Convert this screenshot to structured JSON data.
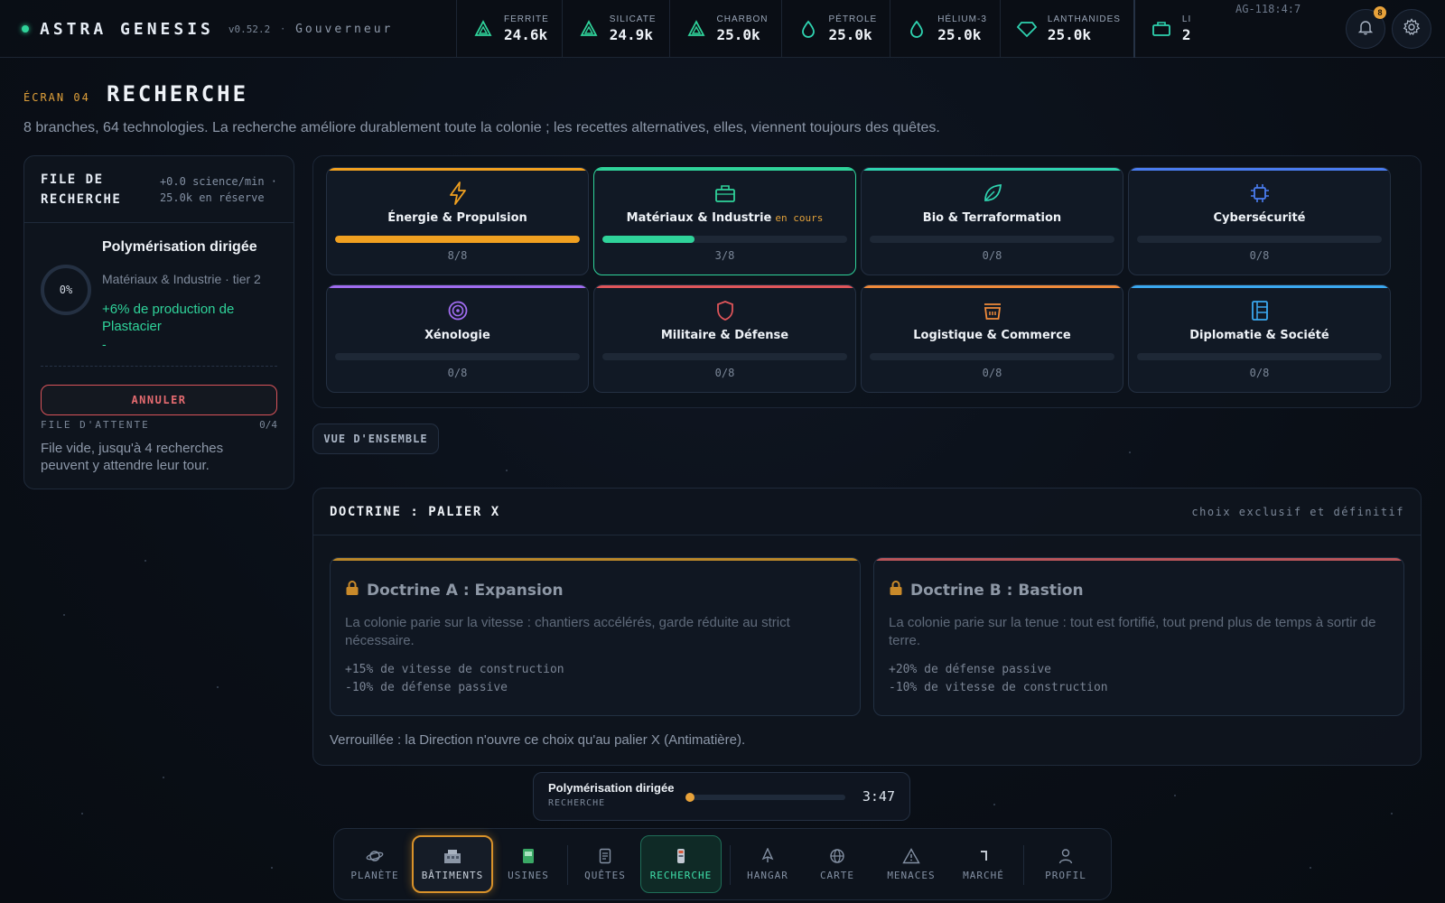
{
  "app": {
    "name": "ASTRA GENESIS",
    "version": "v0.52.2",
    "separator": "·",
    "role": "Gouverneur",
    "coords": "AG-118:4:7",
    "notifications": "8"
  },
  "resources": [
    {
      "name": "FERRITE",
      "value": "24.6k",
      "icon": "triangle-icon"
    },
    {
      "name": "SILICATE",
      "value": "24.9k",
      "icon": "triangle-icon"
    },
    {
      "name": "CHARBON",
      "value": "25.0k",
      "icon": "triangle-icon"
    },
    {
      "name": "PÉTROLE",
      "value": "25.0k",
      "icon": "drop-icon"
    },
    {
      "name": "HÉLIUM-3",
      "value": "25.0k",
      "icon": "drop-icon"
    },
    {
      "name": "LANTHANIDES",
      "value": "25.0k",
      "icon": "gem-icon"
    },
    {
      "name": "LI",
      "value": "2",
      "icon": "crate-icon"
    }
  ],
  "header": {
    "screen": "ÉCRAN 04",
    "title": "RECHERCHE",
    "subtitle": "8 branches, 64 technologies. La recherche améliore durablement toute la colonie ; les recettes alternatives, elles, viennent toujours des quêtes."
  },
  "queue": {
    "title_line1": "FILE DE",
    "title_line2": "RECHERCHE",
    "rate": "+0.0 science/min ·",
    "reserve": "25.0k en réserve",
    "progress": "0%",
    "current_name": "Polymérisation dirigée",
    "current_branch": "Matériaux & Industrie · tier 2",
    "current_effect": "+6% de production de Plastacier",
    "current_dash": "-",
    "cancel_label": "ANNULER",
    "wait_label": "FILE D'ATTENTE",
    "wait_count": "0/4",
    "wait_empty": "File vide, jusqu'à 4 recherches peuvent y attendre leur tour."
  },
  "branches": [
    {
      "name": "Énergie & Propulsion",
      "status": "",
      "count": "8/8",
      "progress": 1.0,
      "color": "#f0a020",
      "icon": "lightning-icon"
    },
    {
      "name": "Matériaux & Industrie",
      "status": "en cours",
      "count": "3/8",
      "progress": 0.375,
      "color": "#2fd39a",
      "icon": "factory-icon"
    },
    {
      "name": "Bio & Terraformation",
      "status": "",
      "count": "0/8",
      "progress": 0,
      "color": "#2fd3b0",
      "icon": "leaf-icon"
    },
    {
      "name": "Cybersécurité",
      "status": "",
      "count": "0/8",
      "progress": 0,
      "color": "#4a7cf0",
      "icon": "chip-icon"
    },
    {
      "name": "Xénologie",
      "status": "",
      "count": "0/8",
      "progress": 0,
      "color": "#a06cf0",
      "icon": "target-icon"
    },
    {
      "name": "Militaire & Défense",
      "status": "",
      "count": "0/8",
      "progress": 0,
      "color": "#e0555a",
      "icon": "shield-icon"
    },
    {
      "name": "Logistique & Commerce",
      "status": "",
      "count": "0/8",
      "progress": 0,
      "color": "#f08a3a",
      "icon": "basket-icon"
    },
    {
      "name": "Diplomatie & Société",
      "status": "",
      "count": "0/8",
      "progress": 0,
      "color": "#3aa8f0",
      "icon": "columns-icon"
    }
  ],
  "overview_label": "VUE D'ENSEMBLE",
  "doctrine": {
    "title": "DOCTRINE : PALIER X",
    "note": "choix exclusif et définitif",
    "cards": [
      {
        "title": "Doctrine A : Expansion",
        "desc": "La colonie parie sur la vitesse : chantiers accélérés, garde réduite au strict nécessaire.",
        "effect1": "+15% de vitesse de construction",
        "effect2": "-10% de défense passive",
        "color": "#b8862a"
      },
      {
        "title": "Doctrine B : Bastion",
        "desc": "La colonie parie sur la tenue : tout est fortifié, tout prend plus de temps à sortir de terre.",
        "effect1": "+20% de défense passive",
        "effect2": "-10% de vitesse de construction",
        "color": "#b8555a"
      }
    ],
    "lock_note": "Verrouillée : la Direction n'ouvre ce choix qu'au palier X (Antimatière)."
  },
  "current_bar": {
    "name": "Polymérisation dirigée",
    "type": "RECHERCHE",
    "time": "3:47",
    "progress": 0.0
  },
  "nav": [
    {
      "label": "PLANÈTE",
      "icon": "planet-icon"
    },
    {
      "label": "BÂTIMENTS",
      "icon": "buildings-icon"
    },
    {
      "label": "USINES",
      "icon": "factory-icon"
    },
    {
      "label": "QUÊTES",
      "icon": "scroll-icon"
    },
    {
      "label": "RECHERCHE",
      "icon": "flask-icon"
    },
    {
      "label": "HANGAR",
      "icon": "ship-icon"
    },
    {
      "label": "CARTE",
      "icon": "globe-icon"
    },
    {
      "label": "MENACES",
      "icon": "warning-icon"
    },
    {
      "label": "MARCHÉ",
      "icon": "market-icon"
    },
    {
      "label": "PROFIL",
      "icon": "user-icon"
    }
  ]
}
